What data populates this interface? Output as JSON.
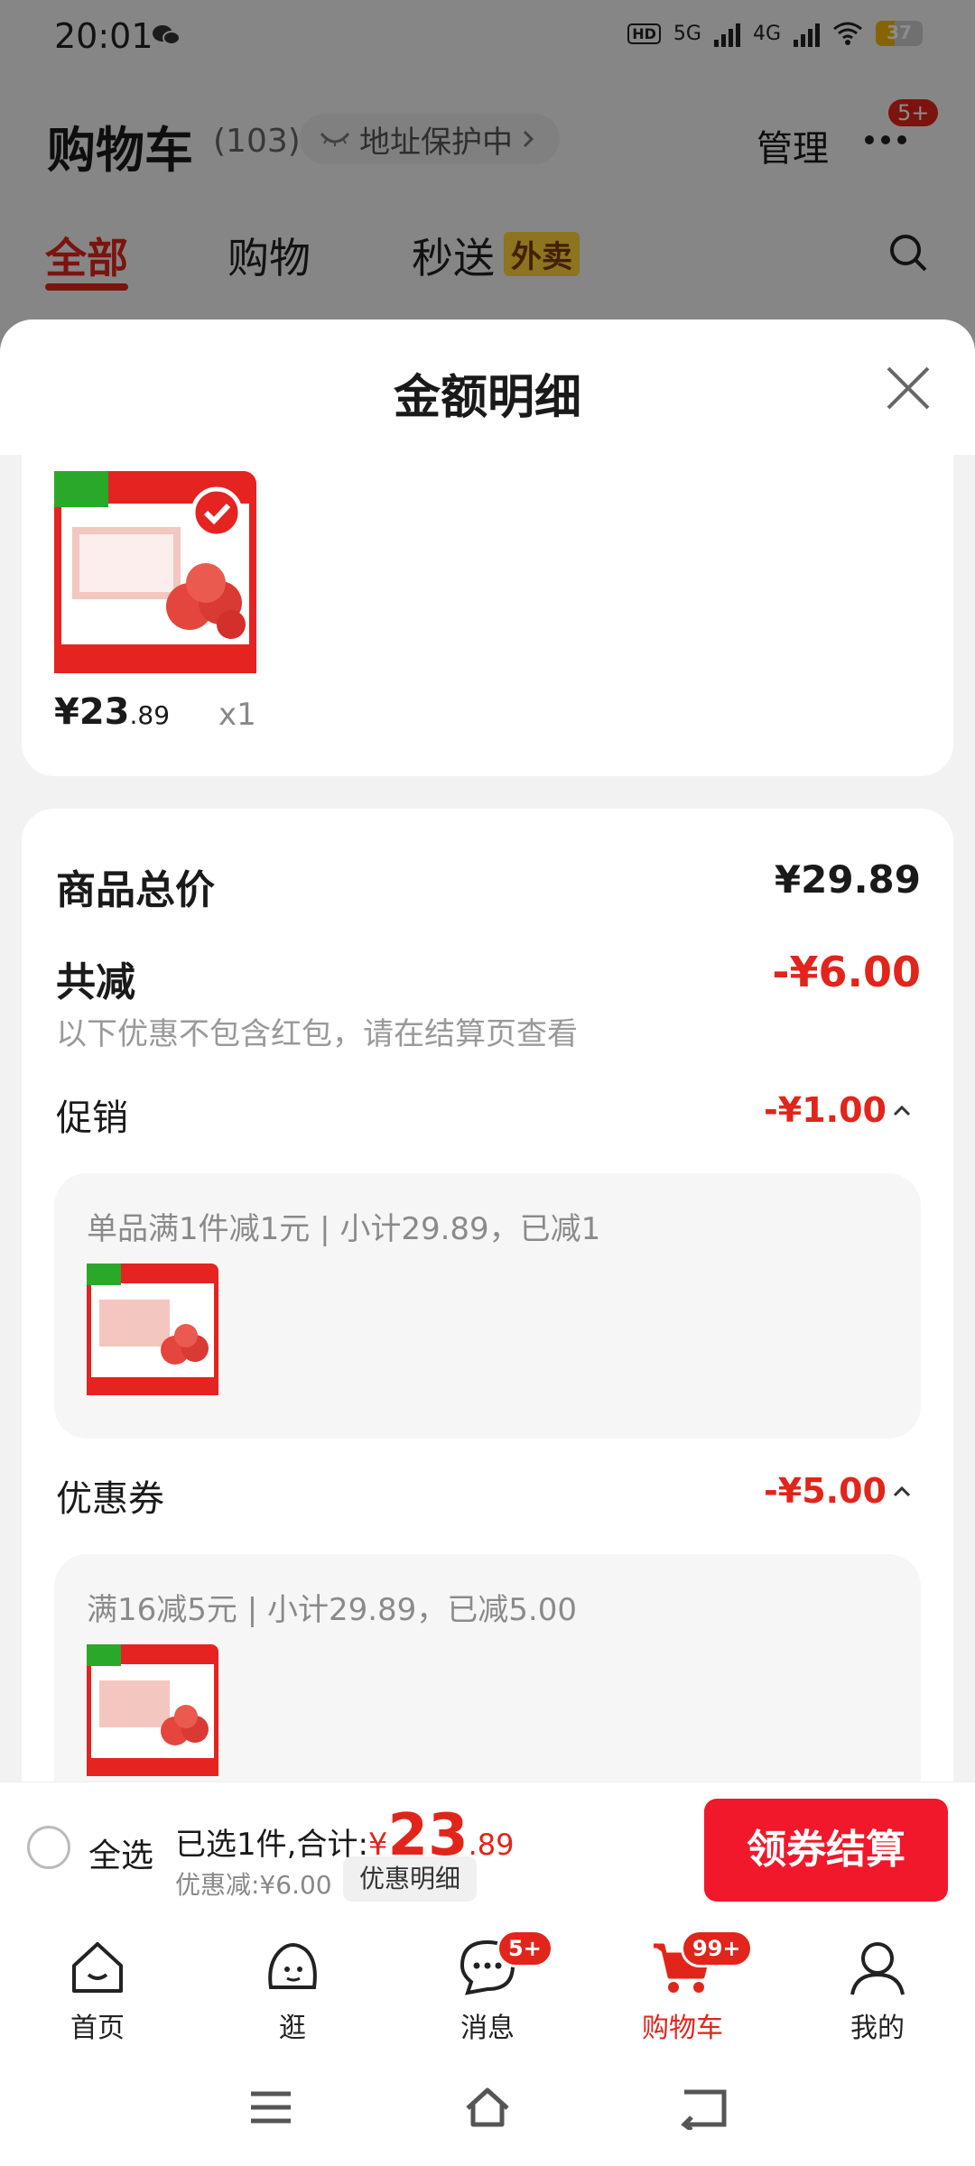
{
  "status": {
    "time": "20:01",
    "net1": "5G",
    "net2": "4G",
    "hd": "HD",
    "battery": "37"
  },
  "header": {
    "title": "购物车",
    "count": "(103)",
    "address_pill": "地址保护中",
    "manage": "管理",
    "more_badge": "5+"
  },
  "tabs": [
    {
      "label": "全部"
    },
    {
      "label": "购物"
    },
    {
      "label": "秒送"
    }
  ],
  "tab_tag": "外卖",
  "sheet": {
    "title": "金额明细",
    "product": {
      "price_int": "¥23",
      "price_dec": ".89",
      "qty": "x1"
    },
    "total_label": "商品总价",
    "total_value": "¥29.89",
    "reduce_label": "共减",
    "reduce_value": "-¥6.00",
    "note": "以下优惠不包含红包，请在结算页查看",
    "promo": {
      "label": "促销",
      "value": "-¥1.00",
      "detail": "单品满1件减1元 | 小计29.89，已减1"
    },
    "coupon": {
      "label": "优惠券",
      "value": "-¥5.00",
      "detail": "满16减5元 | 小计29.89，已减5.00"
    }
  },
  "checkout": {
    "select_all": "全选",
    "selected": "已选1件,合计:",
    "yen": "¥",
    "total_int": "23",
    "total_dec": ".89",
    "discount": "优惠减:¥6.00",
    "detail_button": "优惠明细",
    "pay_button": "领券结算"
  },
  "tabbar": [
    {
      "label": "首页"
    },
    {
      "label": "逛"
    },
    {
      "label": "消息",
      "badge": "5+"
    },
    {
      "label": "购物车",
      "badge": "99+"
    },
    {
      "label": "我的"
    }
  ],
  "colors": {
    "accent": "#e1251b",
    "pay": "#f0182a",
    "tag": "#ffd43b"
  },
  "icons": [
    "wechat-icon",
    "wifi-icon",
    "battery-icon",
    "mask-icon",
    "chevron-right-icon",
    "more-icon",
    "search-icon",
    "close-icon",
    "check-icon",
    "chevron-up-icon",
    "home-icon",
    "browse-icon",
    "message-icon",
    "cart-icon",
    "profile-icon",
    "menu-icon",
    "nav-home-icon",
    "back-icon"
  ]
}
